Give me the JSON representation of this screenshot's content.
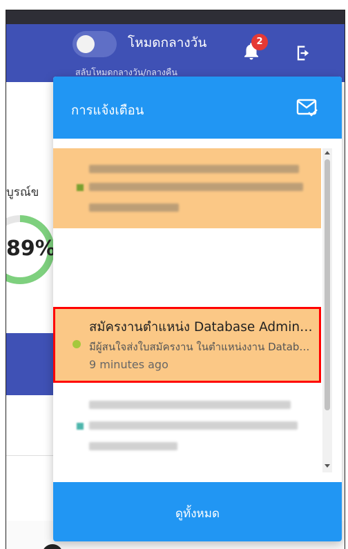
{
  "header": {
    "mode_label": "โหมดกลางวัน",
    "mode_hint": "สลับโหมดกลางวัน/กลางคืน",
    "notification_count": "2",
    "toggle_state": "off"
  },
  "background": {
    "partial_text": "บูรณ์ข",
    "percent": "89%"
  },
  "notifications": {
    "title": "การแจ้งเตือน",
    "view_all_label": "ดูทั้งหมด",
    "selected": {
      "title": "สมัครงานตำแหน่ง Database Administrator",
      "body": "มีผู้สนใจส่งใบสมัครงาน ในตำแหน่งงาน Database Administrator",
      "time": "9 minutes ago"
    }
  },
  "colors": {
    "header": "#3f51b5",
    "accent": "#2196f3",
    "unread_bg": "#fbc886",
    "badge": "#e53935",
    "highlight_border": "#ff0000",
    "dot": "#a5c83c"
  }
}
